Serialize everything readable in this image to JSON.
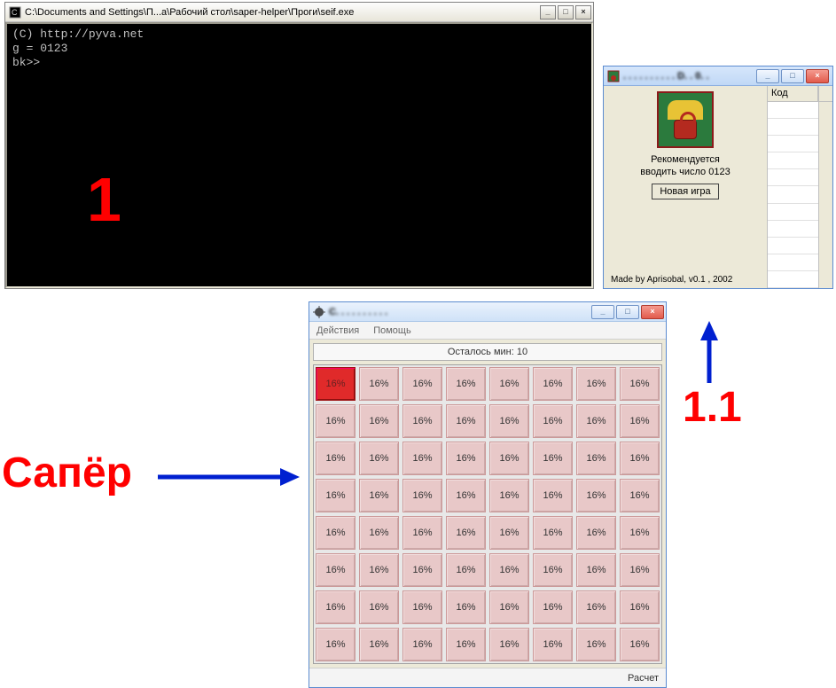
{
  "console": {
    "title": "C:\\Documents and Settings\\П...а\\Рабочий стол\\saper-helper\\Проги\\seif.exe",
    "lines": {
      "l1": "(C) http://pyva.net",
      "l2": "",
      "l3": "g = 0123",
      "l4": "bk>>"
    },
    "buttons": {
      "min": "_",
      "max": "□",
      "close": "×"
    },
    "overlay_label": "1"
  },
  "helper": {
    "buttons": {
      "min": "_",
      "max": "□",
      "close": "×"
    },
    "recommend_line1": "Рекомендуется",
    "recommend_line2": "вводить число 0123",
    "new_game": "Новая игра",
    "footer": "Made by Aprisobal, v0.1 , 2002",
    "code_col": "Код"
  },
  "saper": {
    "buttons": {
      "min": "_",
      "max": "□",
      "close": "×"
    },
    "menu": {
      "actions": "Действия",
      "help": "Помощь"
    },
    "status": "Осталось мин: 10",
    "cell_value": "16%",
    "hot_value": "16%",
    "footer_btn": "Расчет"
  },
  "annotations": {
    "saper_label": "Сапёр",
    "one_one": "1.1"
  },
  "chart_data": {
    "type": "table",
    "title": "Осталось мин: 10",
    "rows": 8,
    "cols": 8,
    "grid": [
      [
        "16%",
        "16%",
        "16%",
        "16%",
        "16%",
        "16%",
        "16%",
        "16%"
      ],
      [
        "16%",
        "16%",
        "16%",
        "16%",
        "16%",
        "16%",
        "16%",
        "16%"
      ],
      [
        "16%",
        "16%",
        "16%",
        "16%",
        "16%",
        "16%",
        "16%",
        "16%"
      ],
      [
        "16%",
        "16%",
        "16%",
        "16%",
        "16%",
        "16%",
        "16%",
        "16%"
      ],
      [
        "16%",
        "16%",
        "16%",
        "16%",
        "16%",
        "16%",
        "16%",
        "16%"
      ],
      [
        "16%",
        "16%",
        "16%",
        "16%",
        "16%",
        "16%",
        "16%",
        "16%"
      ],
      [
        "16%",
        "16%",
        "16%",
        "16%",
        "16%",
        "16%",
        "16%",
        "16%"
      ],
      [
        "16%",
        "16%",
        "16%",
        "16%",
        "16%",
        "16%",
        "16%",
        "16%"
      ]
    ],
    "highlighted_cell": {
      "row": 0,
      "col": 0
    },
    "note": "Minesweeper probability helper — every cell shows estimated mine probability 16%; top-left cell is highlighted red."
  }
}
